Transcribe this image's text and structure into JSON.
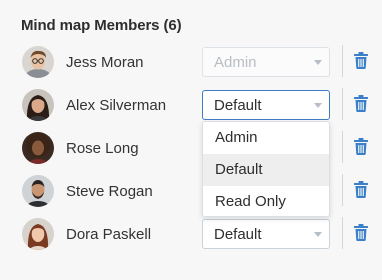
{
  "panel": {
    "title": "Mind map Members (6)"
  },
  "colors": {
    "accent": "#3d7cc4",
    "trash": "#3a7fc8"
  },
  "members": [
    {
      "name": "Jess Moran",
      "role": "Admin",
      "role_disabled": true,
      "avatar_icon": "avatar-man-glasses"
    },
    {
      "name": "Alex Silverman",
      "role": "Default",
      "dropdown_open": true,
      "avatar_icon": "avatar-woman-dark-hair"
    },
    {
      "name": "Rose Long",
      "role": "Default",
      "avatar_icon": "avatar-woman-curly-hair"
    },
    {
      "name": "Steve Rogan",
      "role": "Default",
      "avatar_icon": "avatar-man-beard"
    },
    {
      "name": "Dora Paskell",
      "role": "Default",
      "avatar_icon": "avatar-woman-auburn-hair"
    }
  ],
  "role_options": [
    "Admin",
    "Default",
    "Read Only"
  ],
  "dropdown": {
    "highlighted_option": "Default"
  },
  "icons": {
    "delete": "trash-icon",
    "select_caret": "chevron-down-icon"
  }
}
